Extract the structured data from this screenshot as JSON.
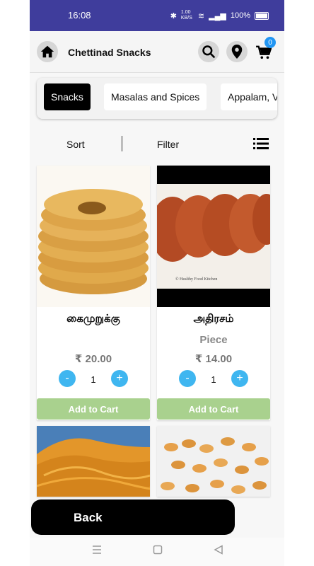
{
  "status": {
    "time": "16:08",
    "speed": "1.00 KB/S",
    "battery": "100%"
  },
  "header": {
    "title": "Chettinad Snacks",
    "cart_count": "0"
  },
  "categories": [
    {
      "label": "Snacks",
      "active": true
    },
    {
      "label": "Masalas and Spices",
      "active": false
    },
    {
      "label": "Appalam, V",
      "active": false
    }
  ],
  "toolbar": {
    "sort": "Sort",
    "filter": "Filter"
  },
  "products": [
    {
      "name": "கைமுறுக்கு",
      "unit": "",
      "price": "₹ 20.00",
      "qty": "1",
      "cta": "Add to Cart"
    },
    {
      "name": "அதிரசம்",
      "unit": "Piece",
      "price": "₹ 14.00",
      "qty": "1",
      "cta": "Add to Cart",
      "watermark": "© Healthy Food Kitchen"
    },
    {
      "name": "",
      "unit": "",
      "price": "",
      "qty": "",
      "cta": ""
    },
    {
      "name": "",
      "unit": "",
      "price": "",
      "qty": "",
      "cta": ""
    }
  ],
  "footer": {
    "back": "Back"
  },
  "colors": {
    "status_bar": "#3f3d9c",
    "accent_blue": "#3fb6f0",
    "add_to_cart": "#a9d18e",
    "badge": "#2196f3"
  },
  "icons": [
    "home-icon",
    "search-icon",
    "location-pin-icon",
    "cart-icon",
    "list-view-icon",
    "minus-icon",
    "plus-icon",
    "menu-nav-icon",
    "home-nav-icon",
    "back-nav-icon"
  ]
}
